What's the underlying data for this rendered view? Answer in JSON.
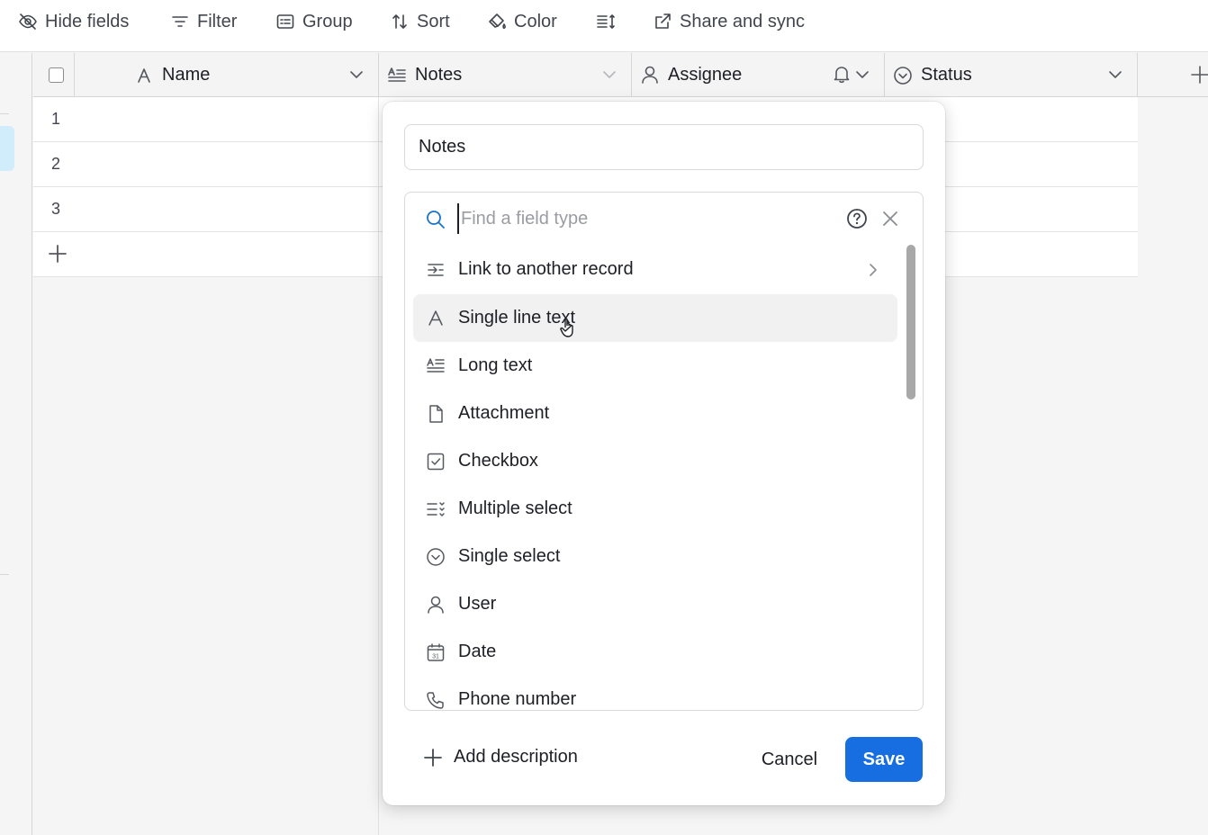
{
  "toolbar": {
    "hide_fields": "Hide fields",
    "filter": "Filter",
    "group": "Group",
    "sort": "Sort",
    "color": "Color",
    "share_sync": "Share and sync"
  },
  "grid": {
    "columns": [
      {
        "label": "Name",
        "icon": "single-line-text-icon"
      },
      {
        "label": "Notes",
        "icon": "long-text-icon"
      },
      {
        "label": "Assignee",
        "icon": "user-icon"
      },
      {
        "label": "Status",
        "icon": "single-select-icon"
      }
    ],
    "rows": [
      "1",
      "2",
      "3"
    ]
  },
  "dialog": {
    "field_name": "Notes",
    "search_placeholder": "Find a field type",
    "field_types": [
      {
        "label": "Link to another record",
        "icon": "link-record-icon",
        "has_submenu": true
      },
      {
        "label": "Single line text",
        "icon": "single-line-text-icon",
        "hovered": true
      },
      {
        "label": "Long text",
        "icon": "long-text-icon"
      },
      {
        "label": "Attachment",
        "icon": "attachment-icon"
      },
      {
        "label": "Checkbox",
        "icon": "checkbox-icon"
      },
      {
        "label": "Multiple select",
        "icon": "multiple-select-icon"
      },
      {
        "label": "Single select",
        "icon": "single-select-icon"
      },
      {
        "label": "User",
        "icon": "user-icon"
      },
      {
        "label": "Date",
        "icon": "date-icon"
      },
      {
        "label": "Phone number",
        "icon": "phone-icon"
      }
    ],
    "add_description": "Add description",
    "cancel": "Cancel",
    "save": "Save",
    "date_icon_day": "31"
  },
  "colors": {
    "accent": "#166ee1",
    "search_icon": "#1a73c8",
    "hover_row": "#f1f1f1",
    "selected_sidebar": "#d1ecfb"
  }
}
